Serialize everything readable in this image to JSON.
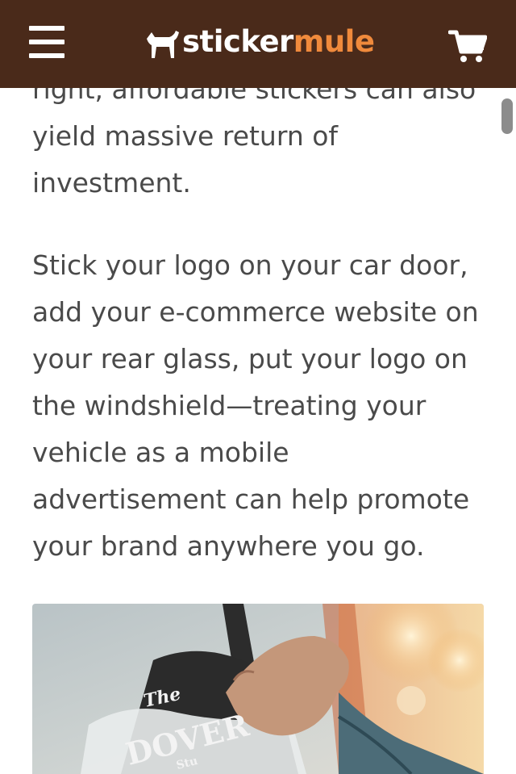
{
  "header": {
    "brand_part1": "sticker",
    "brand_part2": "mule",
    "brand_color_bg": "#4a2a1a",
    "brand_color_accent": "#f08a3c",
    "menu_icon": "hamburger-menu-icon",
    "cart_icon": "shopping-cart-icon"
  },
  "article": {
    "paragraph1": "right, affordable stickers can also yield massive return of investment.",
    "paragraph2": "Stick your logo on your car door, add your e-commerce website on your rear glass, put your logo on the windshield—treating your vehicle as a mobile advertisement can help promote your brand anywhere you go."
  },
  "photo": {
    "sticker_text_1": "The",
    "sticker_text_2": "DOVER",
    "sticker_text_3": "Stu"
  }
}
